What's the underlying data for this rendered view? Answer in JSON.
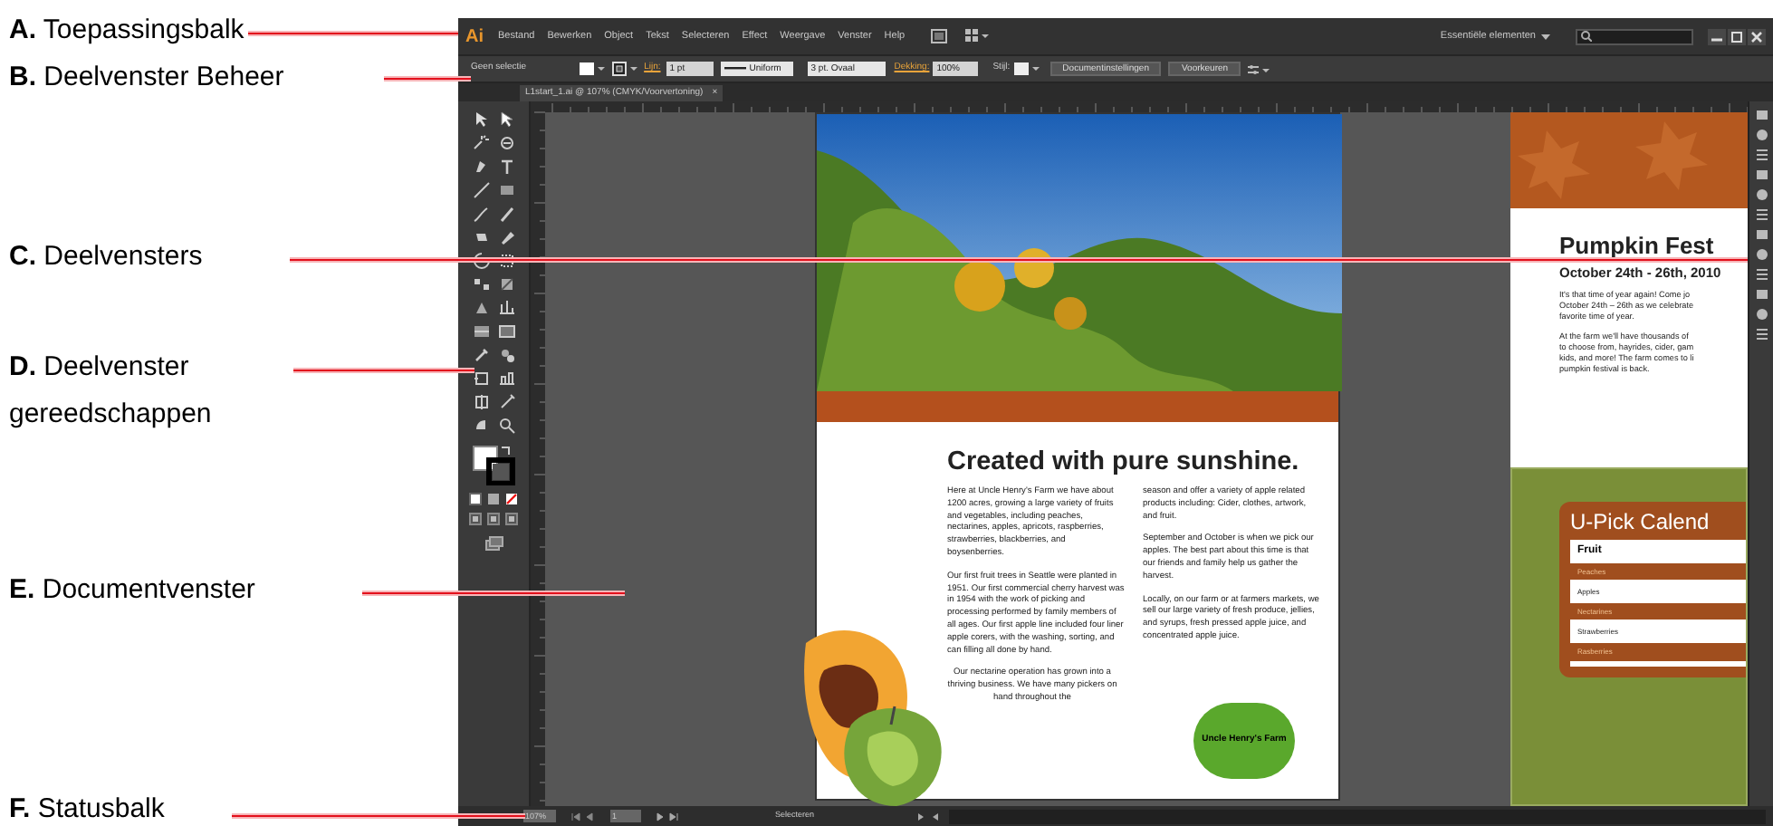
{
  "annotations": [
    {
      "label": "**A.** Toepassingsbalk"
    },
    {
      "label": "**B.** Deelvenster Beheer"
    },
    {
      "label": "**C.** Deelvensters"
    },
    {
      "label": "**D.** Deelvenster gereedschappen"
    },
    {
      "label": "**E.** Documentvenster"
    },
    {
      "label": "**F.** Statusbalk"
    }
  ],
  "app_bar": {
    "logo": "Ai",
    "menus": [
      "Bestand",
      "Bewerken",
      "Object",
      "Tekst",
      "Selecteren",
      "Effect",
      "Weergave",
      "Venster",
      "Help"
    ],
    "workspace": "Essentiële elementen"
  },
  "control_bar": {
    "selection": "Geen selectie",
    "stroke_label": "Lijn:",
    "stroke_weight": "1 pt",
    "profile": "Uniform",
    "brush": "3 pt. Ovaal",
    "opacity_label": "Dekking:",
    "opacity": "100%",
    "style_label": "Stijl:",
    "buttons": [
      "Documentinstellingen",
      "Voorkeuren"
    ]
  },
  "document_tab": {
    "title": "L1start_1.ai @ 107% (CMYK/Voorvertoning)",
    "close": "×"
  },
  "main_artboard": {
    "heading": "Created with pure sunshine.",
    "left_column": [
      "Here at Uncle Henry's Farm we have about 1200 acres, growing a large variety of fruits and vegetables, including peaches, nectarines, apples, apricots, raspberries, strawberries, blackberries, and boysenberries.",
      "Our first fruit trees in Seattle were planted in 1951. Our first commercial cherry harvest was in 1954 with the work of picking and processing performed by family members of all ages. Our first apple line included four liner apple corers, with the washing, sorting, and can filling all done by hand.",
      "Our nectarine operation has grown into a thriving business. We have many pickers on hand throughout the"
    ],
    "right_column": [
      "season and offer a variety of apple related products including: Cider, clothes, artwork, and fruit.",
      "September and October is when we pick our apples. The best part about this time is that our friends and family help us gather the harvest.",
      "Locally, on our farm or at farmers markets, we sell our large variety of fresh produce, jellies, and syrups, fresh pressed apple juice, and concentrated apple juice."
    ],
    "logo": "Uncle Henry's Farm"
  },
  "side_artboard": {
    "title": "Pumpkin Fest",
    "date": "October 24th - 26th, 2010",
    "paragraphs": [
      [
        "It's that time of year again! Come jo",
        "October 24th – 26th as we celebrate",
        "favorite time of year."
      ],
      [
        "At the farm we'll have thousands of",
        "to choose from, hayrides, cider, gam",
        "kids, and more! The farm comes to li",
        "pumpkin festival is back."
      ]
    ],
    "calendar_title": "U-Pick Calend",
    "calendar_header": "Fruit",
    "calendar_rows": [
      "Peaches",
      "Apples",
      "Nectarines",
      "Strawberries",
      "Rasberries"
    ]
  },
  "status_bar": {
    "zoom": "107%",
    "page": "1",
    "tool": "Selecteren"
  }
}
